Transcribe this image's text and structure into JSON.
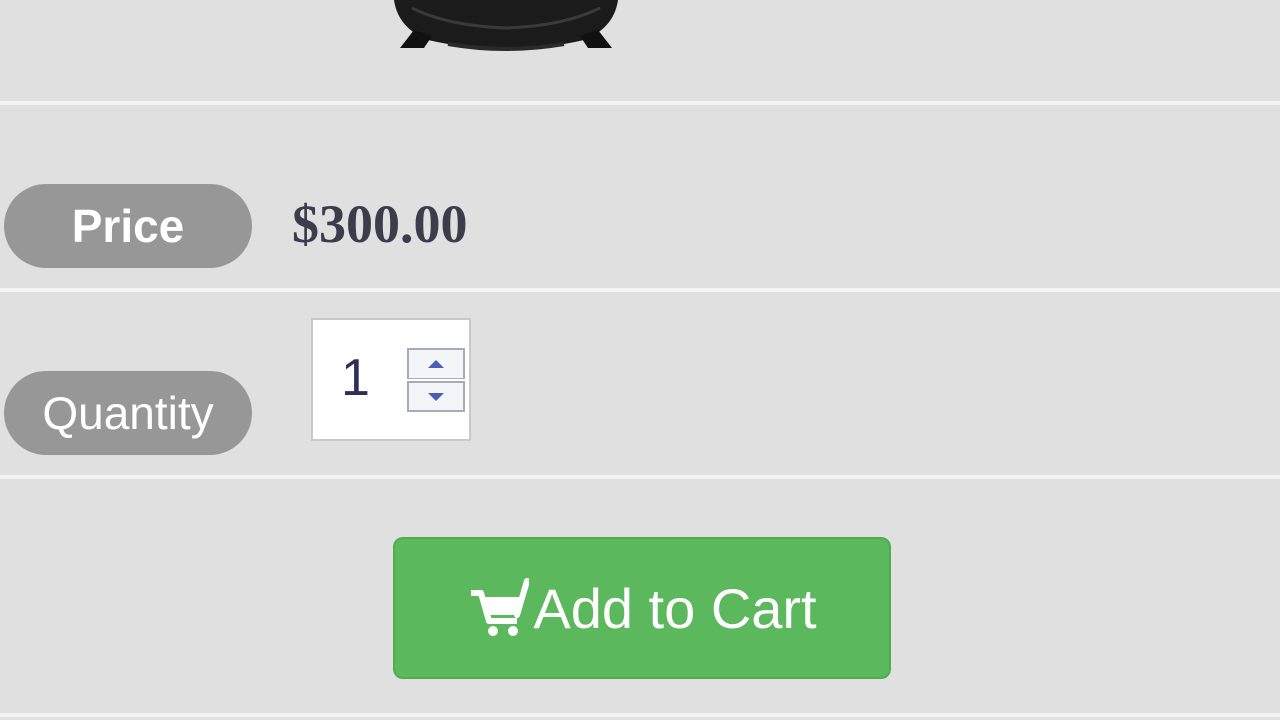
{
  "product": {
    "image_icon": "product-pot-icon",
    "price_label": "Price",
    "price_value": "$300.00",
    "quantity_label": "Quantity",
    "quantity_value": "1"
  },
  "actions": {
    "add_to_cart_label": "Add to Cart",
    "cart_icon": "cart-icon"
  },
  "colors": {
    "background": "#e0e0e0",
    "pill": "#979797",
    "button": "#5cb85c",
    "price_text": "#3c3c4a"
  }
}
